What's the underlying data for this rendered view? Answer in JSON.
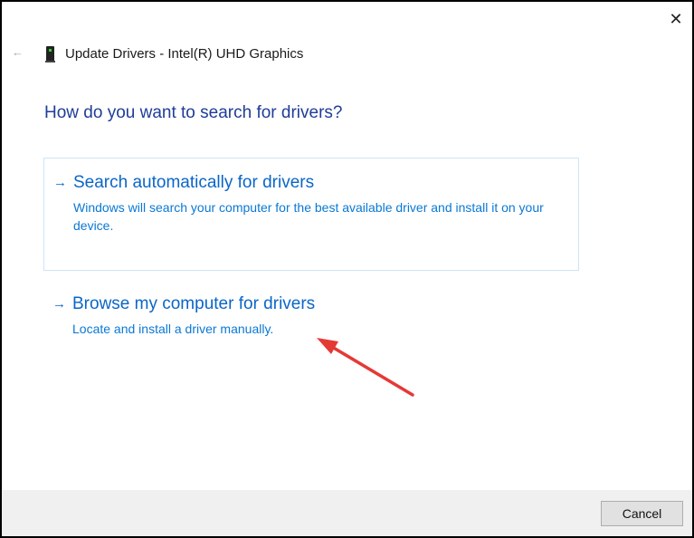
{
  "window": {
    "title": "Update Drivers - Intel(R) UHD Graphics",
    "close_icon": "close-icon",
    "back_icon": "back-arrow-icon"
  },
  "heading": "How do you want to search for drivers?",
  "options": [
    {
      "title": "Search automatically for drivers",
      "description": "Windows will search your computer for the best available driver and install it on your device."
    },
    {
      "title": "Browse my computer for drivers",
      "description": "Locate and install a driver manually."
    }
  ],
  "footer": {
    "cancel_label": "Cancel"
  },
  "colors": {
    "link": "#0a66c8",
    "heading": "#1f3d99",
    "annotation": "#e53935"
  }
}
